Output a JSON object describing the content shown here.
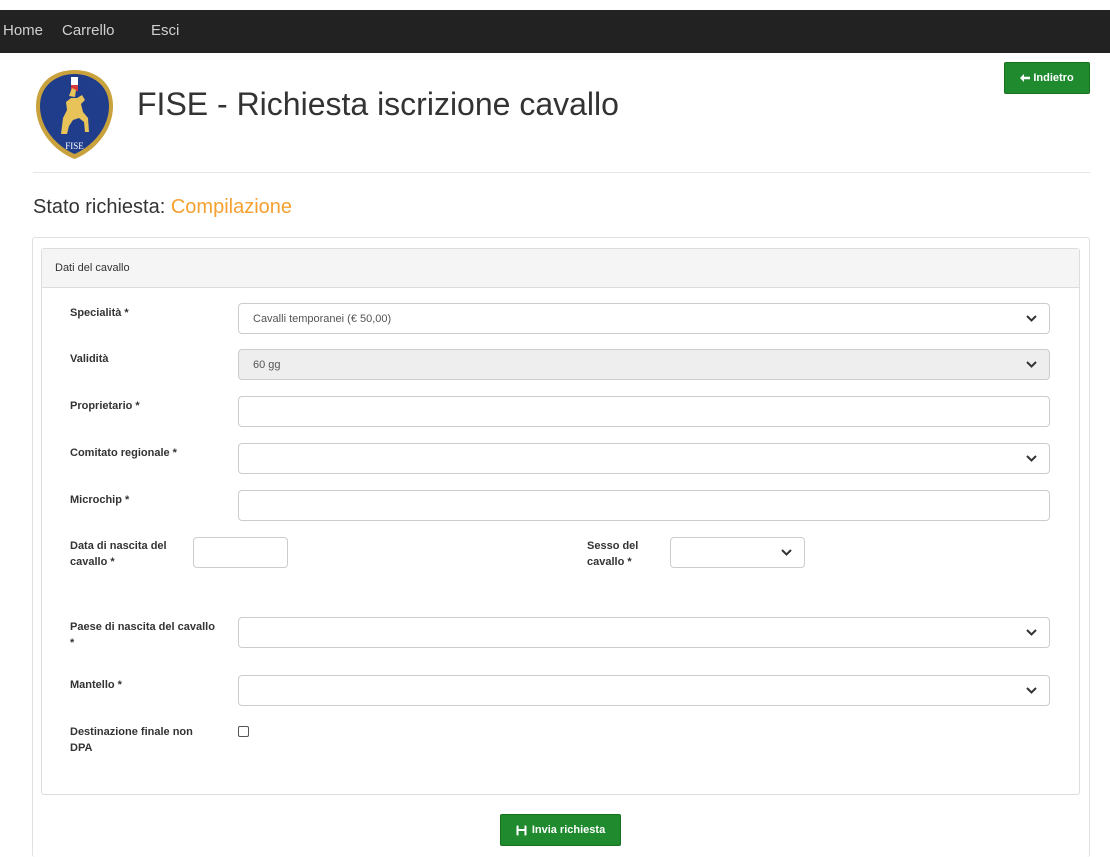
{
  "colors": {
    "navbar": "#222222",
    "primary_button": "#1f8a2e",
    "status_accent": "#f5a031",
    "panel_heading": "#f5f5f5",
    "disabled_field": "#eeeeee"
  },
  "nav": {
    "items": [
      {
        "label": "Home"
      },
      {
        "label": "Carrello"
      },
      {
        "label": "Esci"
      }
    ]
  },
  "header": {
    "logo_icon": "fise-shield-horse-logo",
    "logo_text": "FISE",
    "title": "FISE - Richiesta iscrizione cavallo",
    "back_button": {
      "label": "Indietro",
      "icon": "arrow-left-icon"
    }
  },
  "status": {
    "label": "Stato richiesta:",
    "value": "Compilazione"
  },
  "panel": {
    "heading": "Dati del cavallo"
  },
  "form": {
    "specialita": {
      "label": "Specialità *",
      "value": "Cavalli temporanei (€ 50,00)"
    },
    "validita": {
      "label": "Validità",
      "value": "60 gg",
      "disabled": true
    },
    "proprietario": {
      "label": "Proprietario *",
      "value": ""
    },
    "comitato": {
      "label": "Comitato regionale *",
      "value": ""
    },
    "microchip": {
      "label": "Microchip *",
      "value": ""
    },
    "data_nascita": {
      "label": "Data di nascita del cavallo *",
      "value": ""
    },
    "sesso": {
      "label": "Sesso del cavallo *",
      "value": ""
    },
    "paese_nascita": {
      "label": "Paese di nascita del cavallo *",
      "value": ""
    },
    "mantello": {
      "label": "Mantello *",
      "value": ""
    },
    "destinazione": {
      "label": "Destinazione finale non DPA",
      "checked": false
    }
  },
  "actions": {
    "submit": {
      "label": "Invia richiesta",
      "icon": "save-icon"
    }
  }
}
